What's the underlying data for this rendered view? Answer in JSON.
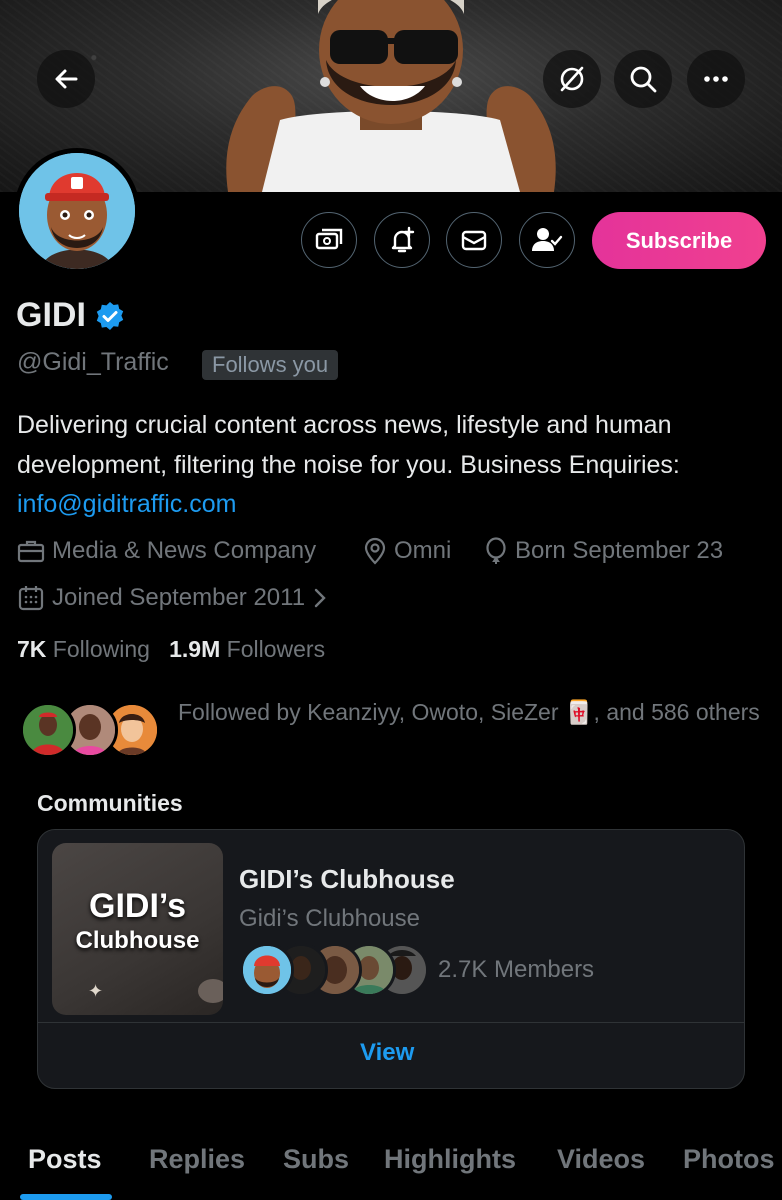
{
  "header": {
    "back_icon": "arrow-left-icon",
    "grok_icon": "slash-circle-icon",
    "search_icon": "search-icon",
    "more_icon": "more-horizontal-icon"
  },
  "actions": {
    "subscribe_label": "Subscribe",
    "icons": [
      "subscription-icon",
      "notification-bell-plus-icon",
      "mail-icon",
      "following-user-check-icon"
    ]
  },
  "profile": {
    "name": "GIDI",
    "handle": "@Gidi_Traffic",
    "follows_you": "Follows you",
    "bio_text": "Delivering crucial content across news, lifestyle and human development, filtering the noise for you. Business Enquiries: ",
    "bio_link": "info@giditraffic.com",
    "category": "Media & News Company",
    "location": "Omni",
    "birthday": "Born September 23",
    "joined": "Joined September 2011",
    "following_count": "7K",
    "following_label": "Following",
    "followers_count": "1.9M",
    "followers_label": "Followers",
    "followed_by": "Followed by Keanziyy, Owoto, SieZer 🀄, and 586 others"
  },
  "communities": {
    "heading": "Communities",
    "card": {
      "thumb_line1": "GIDI’s",
      "thumb_line2": "Clubhouse",
      "title": "GIDI’s Clubhouse",
      "subtitle": "Gidi’s Clubhouse",
      "members": "2.7K Members",
      "view_label": "View"
    }
  },
  "tabs": [
    "Posts",
    "Replies",
    "Subs",
    "Highlights",
    "Videos",
    "Photos"
  ],
  "colors": {
    "accent": "#1d9bf0",
    "subscribe": "#e4339a",
    "muted": "#71767b"
  }
}
